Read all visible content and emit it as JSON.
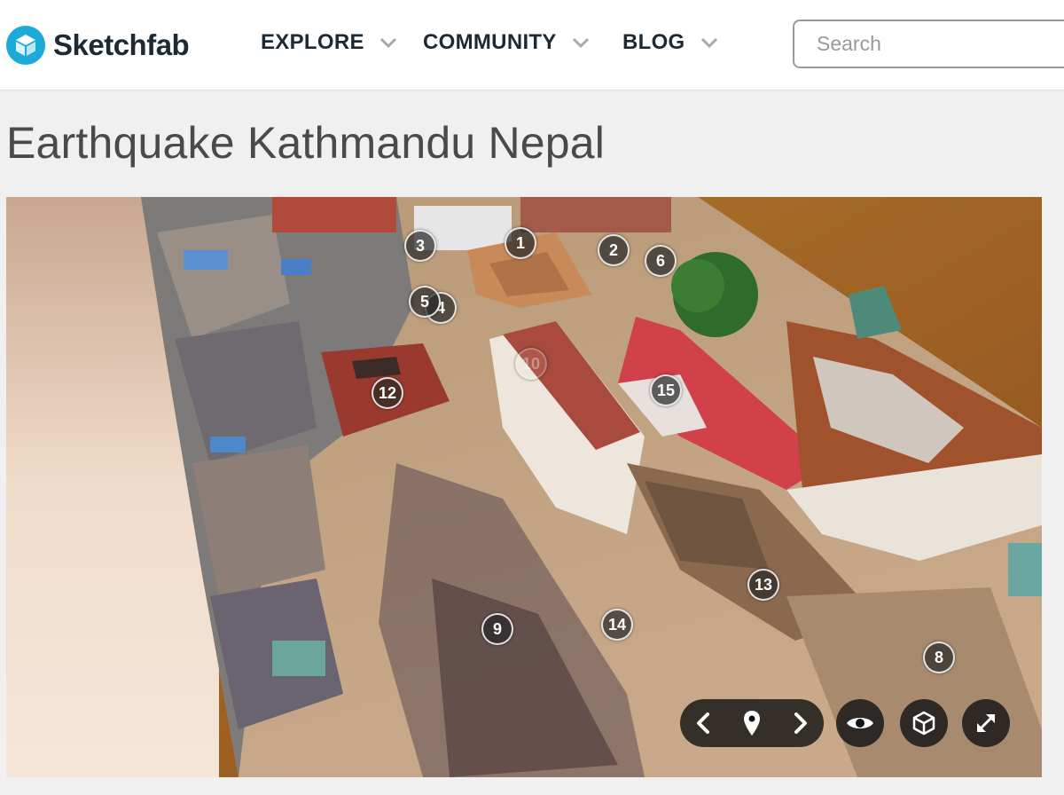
{
  "app": {
    "brand": "Sketchfab",
    "brand_color": "#1caad9",
    "logo_icon": "cube-icon"
  },
  "nav": {
    "items": [
      {
        "label": "EXPLORE",
        "icon": "chevron-down-icon"
      },
      {
        "label": "COMMUNITY",
        "icon": "chevron-down-icon"
      },
      {
        "label": "BLOG",
        "icon": "chevron-down-icon"
      }
    ]
  },
  "search": {
    "placeholder": "Search",
    "value": ""
  },
  "model": {
    "title": "Earthquake Kathmandu Nepal"
  },
  "annotations": {
    "hotspots": [
      "1",
      "2",
      "3",
      "5",
      "6",
      "8",
      "9",
      "10",
      "12",
      "13",
      "14",
      "15"
    ],
    "partially_hidden": [
      "4"
    ],
    "faded": [
      "10"
    ]
  },
  "viewer_controls": {
    "prev_icon": "chevron-left-icon",
    "annotations_icon": "map-pin-icon",
    "next_icon": "chevron-right-icon",
    "view_icon": "eye-icon",
    "vr_icon": "cube-outline-icon",
    "fullscreen_icon": "expand-icon"
  }
}
